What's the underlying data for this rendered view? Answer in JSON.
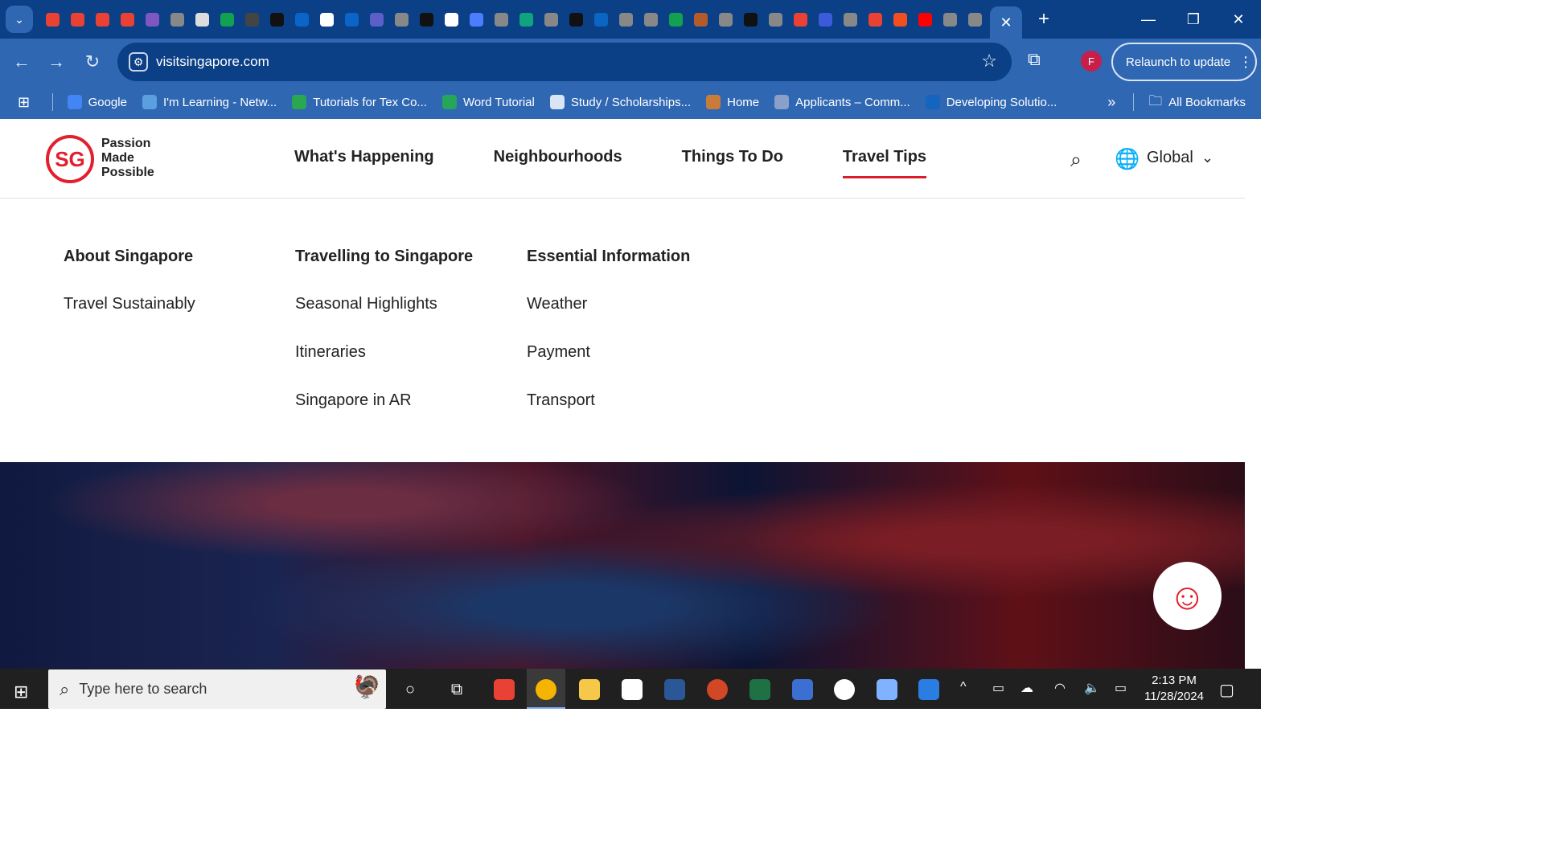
{
  "browser": {
    "url": "visitsingapore.com",
    "profile_initial": "F",
    "relaunch_label": "Relaunch to update",
    "tab_favicon_colors": [
      "#e94235",
      "#e94235",
      "#e94235",
      "#e94235",
      "#7e57c2",
      "#888888",
      "#dddddd",
      "#12a150",
      "#444444",
      "#111111",
      "#0a64c9",
      "#ffffff",
      "#0a64c9",
      "#5b5fc7",
      "#888888",
      "#111111",
      "#ffffff",
      "#4d7dff",
      "#888888",
      "#10a37f",
      "#888888",
      "#111111",
      "#0a66c2",
      "#888888",
      "#888888",
      "#12a150",
      "#b35b2b",
      "#888888",
      "#111111",
      "#888888",
      "#e94235",
      "#3b5bdb",
      "#888888",
      "#e94235",
      "#f24e1e",
      "#ff0000",
      "#888888",
      "#888888"
    ]
  },
  "bookmarks": [
    {
      "label": "Google",
      "color": "#4285f4"
    },
    {
      "label": "I'm Learning - Netw...",
      "color": "#5aa0e0"
    },
    {
      "label": "Tutorials for Tex Co...",
      "color": "#29a84f"
    },
    {
      "label": "Word Tutorial",
      "color": "#26a65b"
    },
    {
      "label": "Study / Scholarships...",
      "color": "#d9e4f5"
    },
    {
      "label": "Home",
      "color": "#c97c3a"
    },
    {
      "label": "Applicants – Comm...",
      "color": "#8aa0c8"
    },
    {
      "label": "Developing Solutio...",
      "color": "#1565c0"
    }
  ],
  "bookmarks_more": "»",
  "all_bookmarks": "All Bookmarks",
  "site": {
    "logo_text": "SG",
    "tagline": "Passion Made Possible",
    "nav": [
      "What's Happening",
      "Neighbourhoods",
      "Things To Do",
      "Travel Tips"
    ],
    "active_nav": "Travel Tips",
    "lang": "Global"
  },
  "menu": {
    "col1": {
      "heading": "About Singapore",
      "links": [
        "Travel Sustainably"
      ]
    },
    "col2": {
      "heading": "Travelling to Singapore",
      "links": [
        "Seasonal Highlights",
        "Itineraries",
        "Singapore in AR"
      ]
    },
    "col3": {
      "heading": "Essential Information",
      "links": [
        "Weather",
        "Payment",
        "Transport"
      ]
    }
  },
  "taskbar": {
    "search_placeholder": "Type here to search",
    "time": "2:13 PM",
    "date": "11/28/2024"
  }
}
